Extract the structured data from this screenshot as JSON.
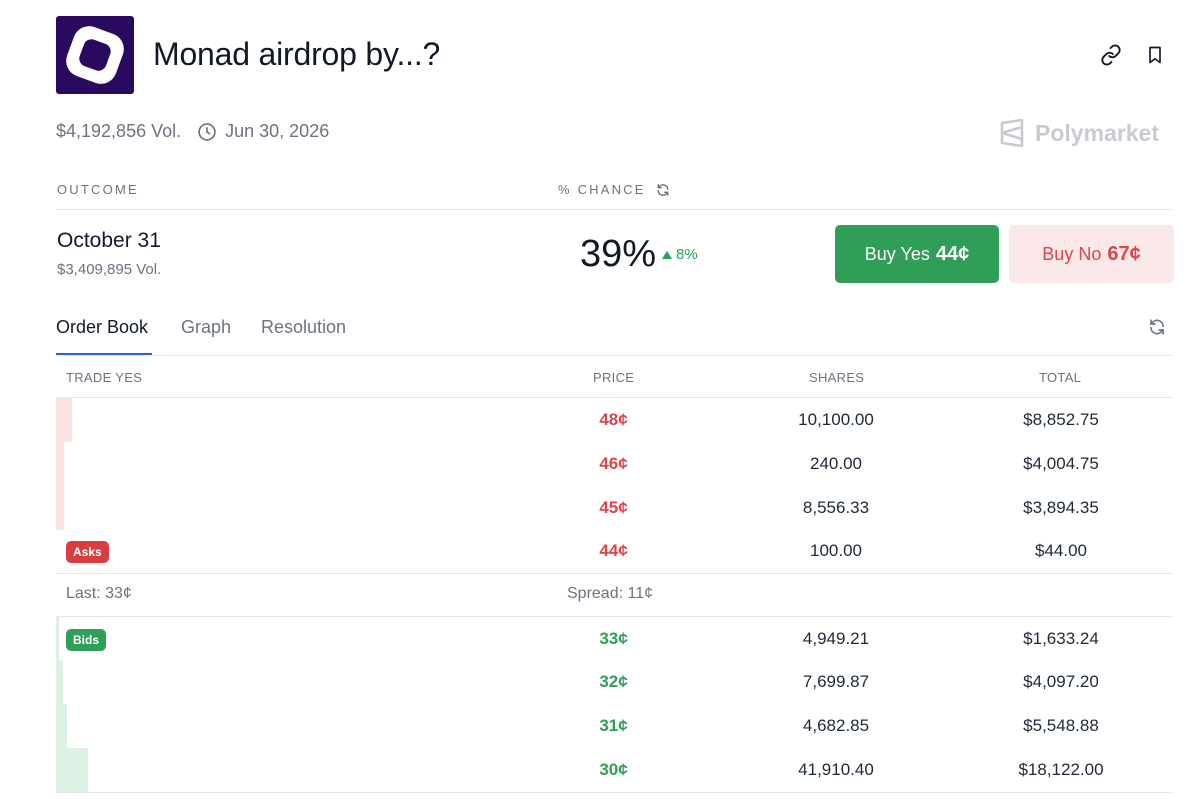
{
  "header": {
    "title": "Monad airdrop by...?",
    "volume": "$4,192,856 Vol.",
    "end_date": "Jun 30, 2026",
    "brand": "Polymarket"
  },
  "columns": {
    "outcome": "OUTCOME",
    "chance": "% CHANCE"
  },
  "outcome": {
    "name": "October 31",
    "volume": "$3,409,895 Vol.",
    "chance": "39%",
    "delta": "8%",
    "buy_yes_label": "Buy Yes",
    "buy_yes_price": "44¢",
    "buy_no_label": "Buy No",
    "buy_no_price": "67¢"
  },
  "tabs": [
    {
      "label": "Order Book",
      "active": true
    },
    {
      "label": "Graph",
      "active": false
    },
    {
      "label": "Resolution",
      "active": false
    }
  ],
  "order_book": {
    "headers": {
      "trade": "TRADE YES",
      "price": "PRICE",
      "shares": "SHARES",
      "total": "TOTAL"
    },
    "asks_label": "Asks",
    "bids_label": "Bids",
    "asks": [
      {
        "price": "48¢",
        "shares": "10,100.00",
        "total": "$8,852.75"
      },
      {
        "price": "46¢",
        "shares": "240.00",
        "total": "$4,004.75"
      },
      {
        "price": "45¢",
        "shares": "8,556.33",
        "total": "$3,894.35"
      },
      {
        "price": "44¢",
        "shares": "100.00",
        "total": "$44.00"
      }
    ],
    "last": "Last: 33¢",
    "spread": "Spread: 11¢",
    "bids": [
      {
        "price": "33¢",
        "shares": "4,949.21",
        "total": "$1,633.24"
      },
      {
        "price": "32¢",
        "shares": "7,699.87",
        "total": "$4,097.20"
      },
      {
        "price": "31¢",
        "shares": "4,682.85",
        "total": "$5,548.88"
      },
      {
        "price": "30¢",
        "shares": "41,910.40",
        "total": "$18,122.00"
      }
    ]
  },
  "colors": {
    "brand_icon_bg": "#2a0a5e",
    "yes_green": "#2f9e57",
    "no_red": "#e0424a",
    "tab_accent": "#2563eb"
  }
}
